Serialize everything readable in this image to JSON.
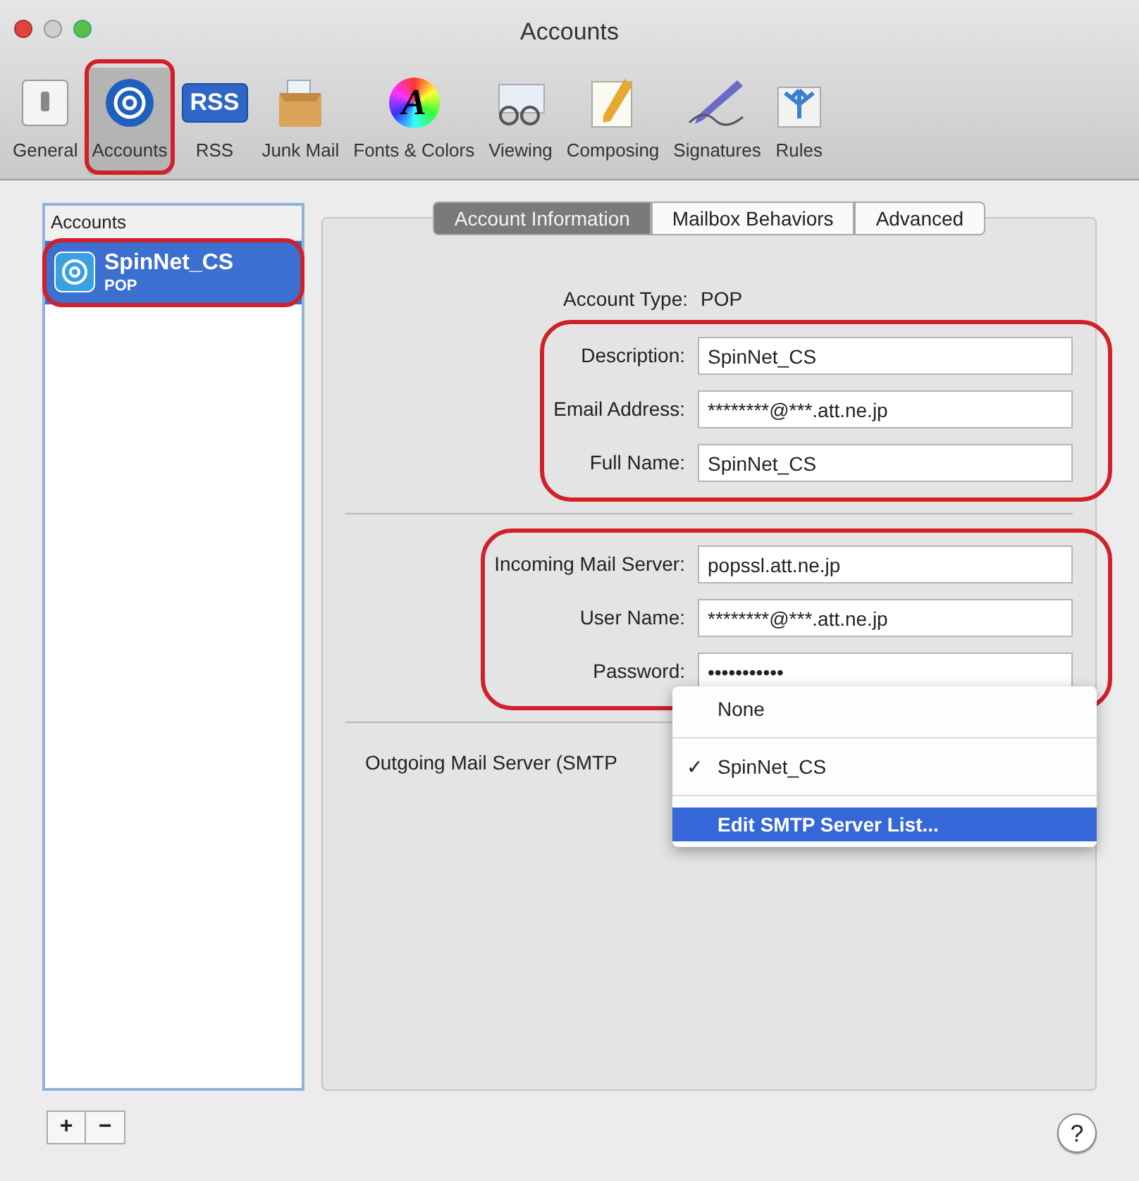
{
  "window": {
    "title": "Accounts"
  },
  "toolbar": [
    {
      "label": "General",
      "kind": "switch",
      "selected": false,
      "highlighted": false
    },
    {
      "label": "Accounts",
      "kind": "at",
      "selected": true,
      "highlighted": true
    },
    {
      "label": "RSS",
      "kind": "rss",
      "badge": "RSS",
      "selected": false,
      "highlighted": false
    },
    {
      "label": "Junk Mail",
      "kind": "box",
      "selected": false,
      "highlighted": false
    },
    {
      "label": "Fonts & Colors",
      "kind": "palette",
      "badge": "A",
      "selected": false,
      "highlighted": false
    },
    {
      "label": "Viewing",
      "kind": "glasses",
      "selected": false,
      "highlighted": false
    },
    {
      "label": "Composing",
      "kind": "notepad",
      "selected": false,
      "highlighted": false
    },
    {
      "label": "Signatures",
      "kind": "pen",
      "selected": false,
      "highlighted": false
    },
    {
      "label": "Rules",
      "kind": "arrows",
      "selected": false,
      "highlighted": false
    }
  ],
  "sidebar": {
    "header": "Accounts",
    "items": [
      {
        "name": "SpinNet_CS",
        "type": "POP",
        "selected": true,
        "highlighted": true
      }
    ]
  },
  "tabs": [
    {
      "label": "Account Information",
      "selected": true
    },
    {
      "label": "Mailbox Behaviors",
      "selected": false
    },
    {
      "label": "Advanced",
      "selected": false
    }
  ],
  "account_type": {
    "label": "Account Type:",
    "value": "POP"
  },
  "field_groups": [
    {
      "highlighted": true,
      "fields": [
        {
          "label": "Description:",
          "value": "SpinNet_CS"
        },
        {
          "label": "Email Address:",
          "value": "********@***.att.ne.jp"
        },
        {
          "label": "Full Name:",
          "value": "SpinNet_CS"
        }
      ]
    },
    {
      "highlighted": true,
      "fields": [
        {
          "label": "Incoming Mail Server:",
          "value": "popssl.att.ne.jp"
        },
        {
          "label": "User Name:",
          "value": "********@***.att.ne.jp"
        },
        {
          "label": "Password:",
          "value": "•••••••••••"
        }
      ]
    }
  ],
  "outgoing": {
    "label": "Outgoing Mail Server (SMTP"
  },
  "smtp_menu": [
    {
      "label": "None",
      "checked": false,
      "selected": false
    },
    {
      "label": "SpinNet_CS",
      "checked": true,
      "selected": false
    },
    {
      "label": "Edit SMTP Server List...",
      "checked": false,
      "selected": true
    }
  ],
  "check_mark": "✓",
  "footer": {
    "add": "+",
    "remove": "−",
    "help": "?"
  }
}
